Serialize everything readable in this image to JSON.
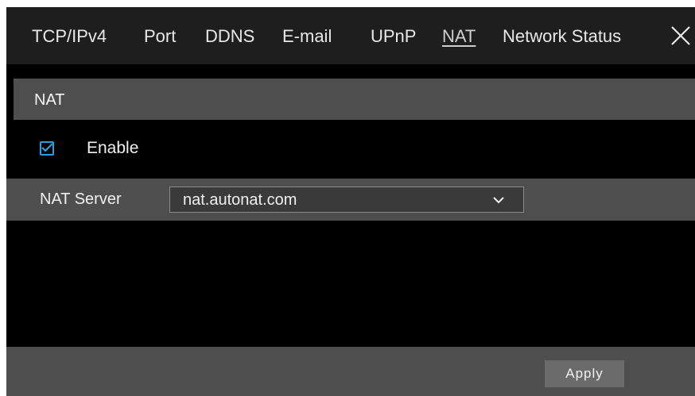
{
  "tabs": [
    {
      "label": "TCP/IPv4",
      "active": false
    },
    {
      "label": "Port",
      "active": false
    },
    {
      "label": "DDNS",
      "active": false
    },
    {
      "label": "E-mail",
      "active": false
    },
    {
      "label": "UPnP",
      "active": false
    },
    {
      "label": "NAT",
      "active": true
    },
    {
      "label": "Network Status",
      "active": false
    }
  ],
  "close_icon": "close-icon",
  "section": {
    "title": "NAT"
  },
  "enable": {
    "label": "Enable",
    "checked": true
  },
  "nat_server": {
    "label": "NAT Server",
    "value": "nat.autonat.com"
  },
  "footer": {
    "apply_label": "Apply"
  },
  "colors": {
    "accent": "#2a9fe0",
    "background": "#000000",
    "panel": "#4e4e4e",
    "tabbar": "#1e1e1e",
    "button": "#6b6b6b"
  }
}
